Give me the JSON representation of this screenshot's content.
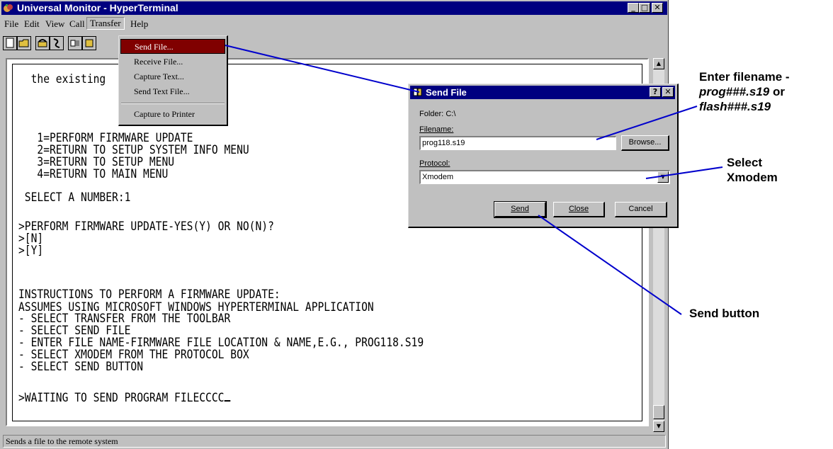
{
  "window": {
    "title": "Universal Monitor - HyperTerminal",
    "buttons": [
      "_",
      "□",
      "✕"
    ]
  },
  "menubar": [
    "File",
    "Edit",
    "View",
    "Call",
    "Transfer",
    "Help"
  ],
  "toolbar": {
    "icons": [
      "new-icon",
      "open-icon",
      "connect-icon",
      "disconnect-icon",
      "send-icon",
      "receive-icon"
    ]
  },
  "transfer_menu": {
    "items": [
      "Send File...",
      "Receive File...",
      "Capture Text...",
      "Send Text File...",
      "Capture to Printer"
    ],
    "highlighted": "Send File..."
  },
  "terminal": {
    "lines": [
      "  the existing",
      "",
      "",
      "   1=PERFORM FIRMWARE UPDATE",
      "   2=RETURN TO SETUP SYSTEM INFO MENU",
      "   3=RETURN TO SETUP MENU",
      "   4=RETURN TO MAIN MENU",
      "",
      " SELECT A NUMBER:1",
      "",
      ">PERFORM FIRMWARE UPDATE-YES(Y) OR NO(N)?",
      ">[N]",
      ">[Y]",
      "",
      "",
      "INSTRUCTIONS TO PERFORM A FIRMWARE UPDATE:",
      "ASSUMES USING MICROSOFT WINDOWS HYPERTERMINAL APPLICATION",
      "- SELECT TRANSFER FROM THE TOOLBAR",
      "- SELECT SEND FILE",
      "- ENTER FILE NAME-FIRMWARE FILE LOCATION & NAME,E.G., PROG118.S19",
      "- SELECT XMODEM FROM THE PROTOCOL BOX",
      "- SELECT SEND BUTTON",
      "",
      ">WAITING TO SEND PROGRAM FILECCCC"
    ]
  },
  "statusbar": {
    "text": "Sends a file to the remote system"
  },
  "dialog": {
    "title": "Send File",
    "title_buttons": [
      "?",
      "✕"
    ],
    "folder_label": "Folder:",
    "folder_value": "C:\\",
    "filename_label": "Filename:",
    "filename_value": "prog118.s19",
    "browse_label": "Browse...",
    "protocol_label": "Protocol:",
    "protocol_value": "Xmodem",
    "send_label": "Send",
    "close_label": "Close",
    "cancel_label": "Cancel"
  },
  "annotations": {
    "filename_line1": "Enter filename -",
    "filename_line2_italic": "prog###.s19",
    "filename_line2_rest": " or",
    "filename_line3_italic": "flash###.s19",
    "protocol_line1": "Select",
    "protocol_line2": "Xmodem",
    "send_text": "Send button",
    "line_color": "#0000cc"
  }
}
